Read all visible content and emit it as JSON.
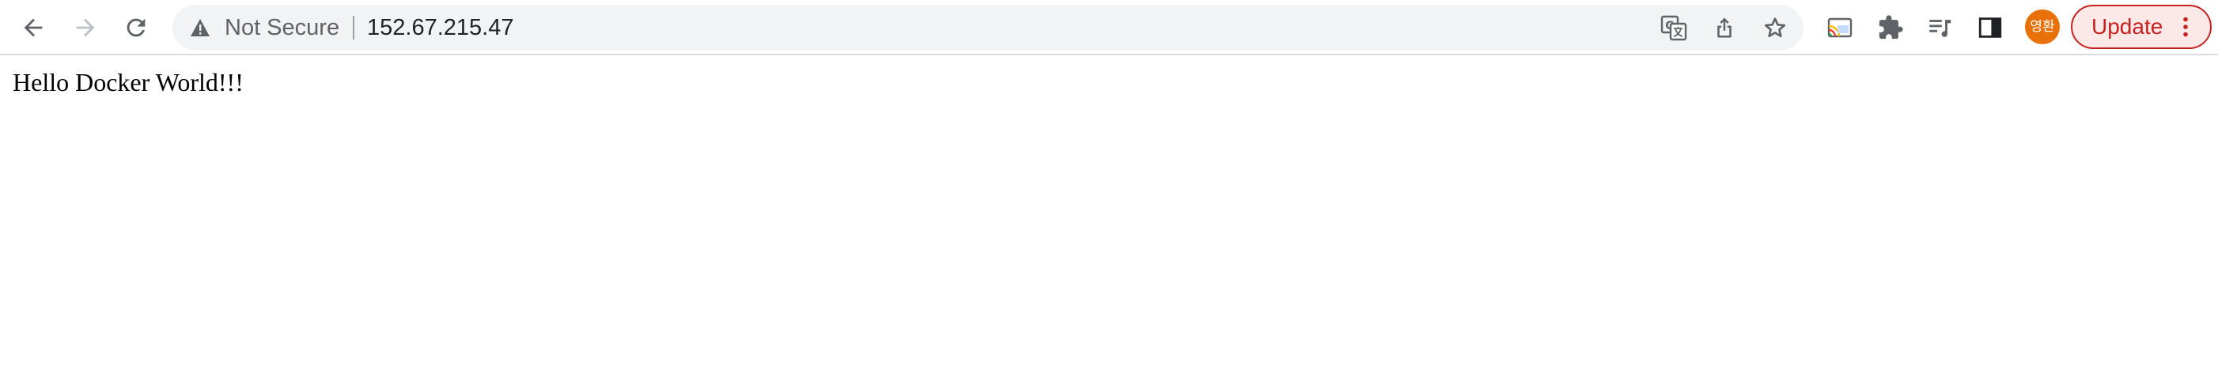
{
  "browser": {
    "security_label": "Not Secure",
    "url": "152.67.215.47",
    "profile_avatar_text": "영환",
    "update_label": "Update",
    "icons": {
      "back": "back-arrow-icon",
      "forward": "forward-arrow-icon",
      "reload": "reload-icon",
      "warning": "warning-triangle-icon",
      "translate": "translate-icon",
      "share": "share-icon",
      "bookmark": "star-icon",
      "cast": "cast-icon",
      "extensions": "puzzle-icon",
      "media": "media-controls-icon",
      "side_panel": "side-panel-icon",
      "menu": "kebab-menu-icon"
    },
    "colors": {
      "omnibox_bg": "#f1f3f4",
      "avatar_bg": "#e8710a",
      "update_accent": "#c5221f"
    }
  },
  "page": {
    "body_text": "Hello Docker World!!!"
  }
}
